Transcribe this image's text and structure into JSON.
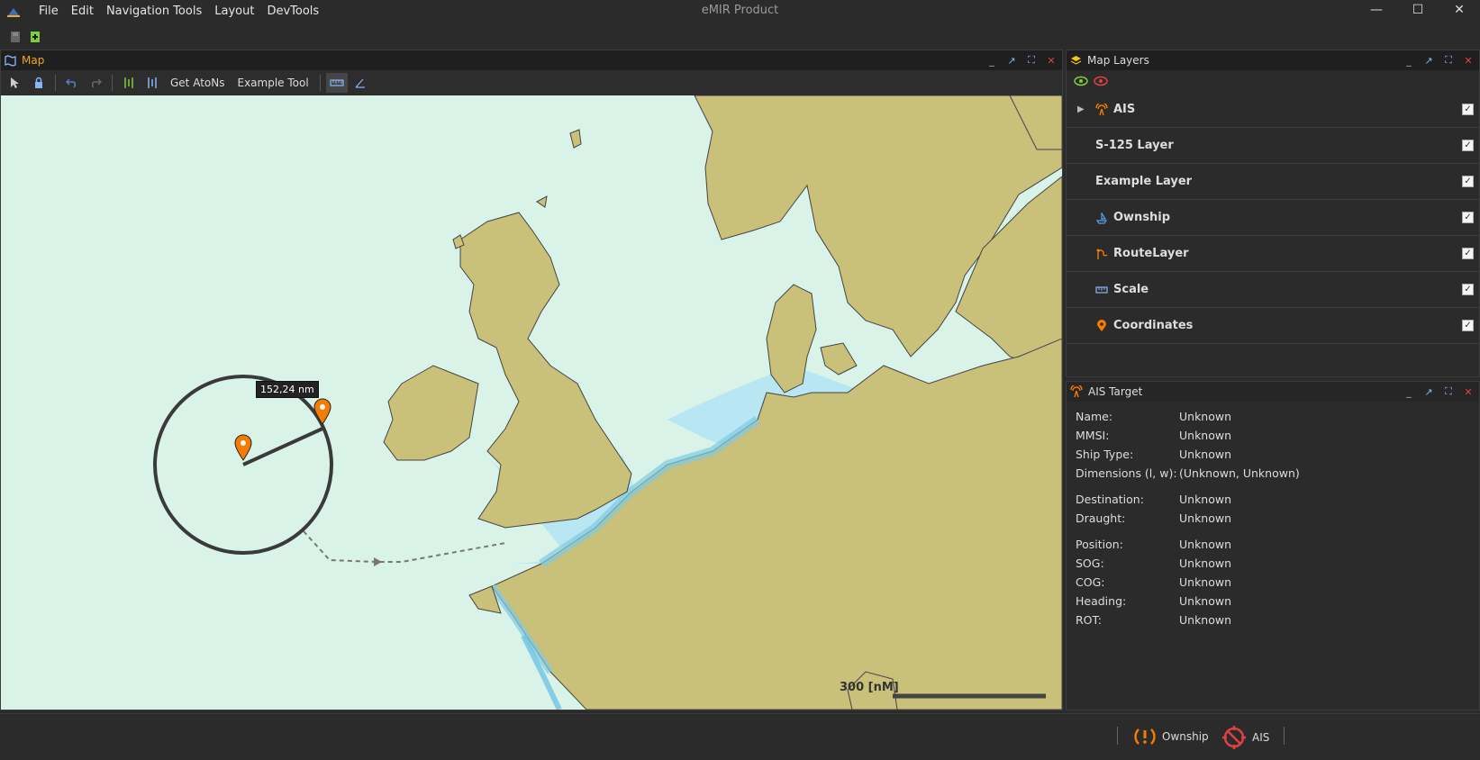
{
  "app": {
    "title": "eMIR Product",
    "menu": [
      "File",
      "Edit",
      "Navigation Tools",
      "Layout",
      "DevTools"
    ]
  },
  "map_panel": {
    "title": "Map",
    "tools": {
      "get_atons": "Get AtoNs",
      "example_tool": "Example Tool"
    },
    "distance_label": "152,24 nm",
    "scale_label": "300 [nM]"
  },
  "layers_panel": {
    "title": "Map Layers",
    "layers": [
      {
        "name": "AIS",
        "checked": true,
        "icon": "ais-icon"
      },
      {
        "name": "S-125 Layer",
        "checked": true,
        "icon": ""
      },
      {
        "name": "Example Layer",
        "checked": true,
        "icon": ""
      },
      {
        "name": "Ownship",
        "checked": true,
        "icon": "ship-icon"
      },
      {
        "name": "RouteLayer",
        "checked": true,
        "icon": "route-icon"
      },
      {
        "name": "Scale",
        "checked": true,
        "icon": "ruler-icon"
      },
      {
        "name": "Coordinates",
        "checked": true,
        "icon": "pin-icon"
      }
    ]
  },
  "ais_panel": {
    "title": "AIS Target",
    "rows": [
      {
        "k": "Name:",
        "v": "Unknown"
      },
      {
        "k": "MMSI:",
        "v": "Unknown"
      },
      {
        "k": "Ship Type:",
        "v": "Unknown"
      },
      {
        "k": "Dimensions (l, w):",
        "v": "(Unknown, Unknown)"
      },
      {
        "k": "Destination:",
        "v": "Unknown"
      },
      {
        "k": "Draught:",
        "v": "Unknown"
      },
      {
        "k": "Position:",
        "v": "Unknown"
      },
      {
        "k": "SOG:",
        "v": "Unknown"
      },
      {
        "k": "COG:",
        "v": "Unknown"
      },
      {
        "k": "Heading:",
        "v": "Unknown"
      },
      {
        "k": "ROT:",
        "v": "Unknown"
      }
    ]
  },
  "status": {
    "ownship": "Ownship",
    "ais": "AIS"
  },
  "colors": {
    "sea": "#d9f3e8",
    "land": "#c9c07a",
    "shallow": "#8ed3ec",
    "accent": "#f5a623"
  }
}
